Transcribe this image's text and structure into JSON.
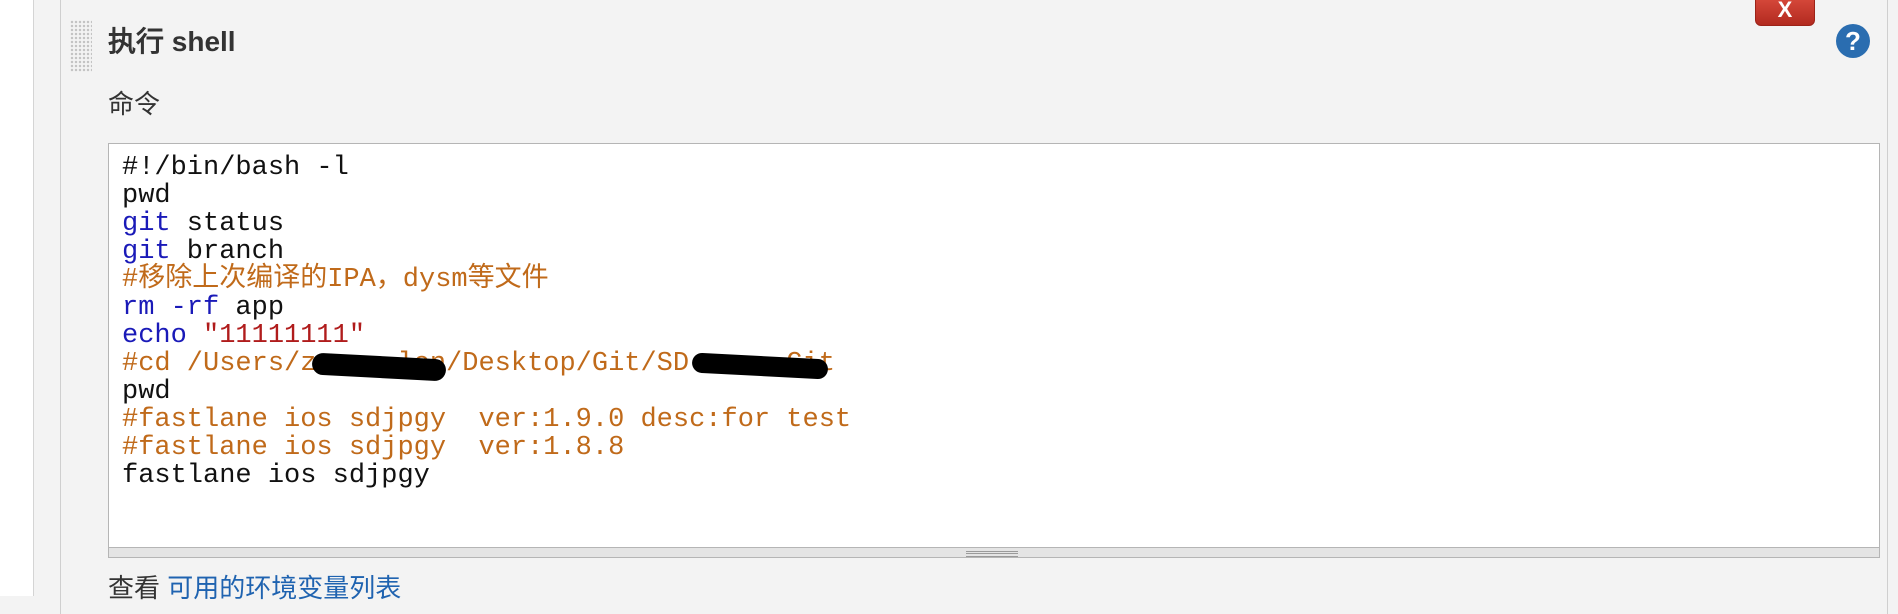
{
  "step": {
    "title": "执行 shell",
    "delete_label": "X",
    "help_label": "?",
    "help_icon": "question-circle-icon",
    "drag_icon": "drag-handle-icon"
  },
  "command": {
    "label": "命令",
    "lines": [
      [
        {
          "t": "#!/bin/bash -l",
          "k": "plain"
        }
      ],
      [
        {
          "t": "pwd",
          "k": "plain"
        }
      ],
      [
        {
          "t": "git",
          "k": "kw"
        },
        {
          "t": " status",
          "k": "plain"
        }
      ],
      [
        {
          "t": "git",
          "k": "kw"
        },
        {
          "t": " branch",
          "k": "plain"
        }
      ],
      [
        {
          "t": "#移除上次编译的IPA，dysm等文件",
          "k": "cmt"
        }
      ],
      [
        {
          "t": "rm",
          "k": "kw"
        },
        {
          "t": " ",
          "k": "plain"
        },
        {
          "t": "-rf",
          "k": "kw"
        },
        {
          "t": " app",
          "k": "plain"
        }
      ],
      [
        {
          "t": "echo",
          "k": "kw"
        },
        {
          "t": " ",
          "k": "plain"
        },
        {
          "t": "\"11111111\"",
          "k": "str"
        }
      ],
      [
        {
          "t": "#cd /Users/zen   len/Desktop/Git/SD      Git",
          "k": "cmt"
        }
      ],
      [
        {
          "t": "pwd",
          "k": "plain"
        }
      ],
      [
        {
          "t": "#fastlane ios sdjpgy  ver:1.9.0 desc:for test",
          "k": "cmt"
        }
      ],
      [
        {
          "t": "#fastlane ios sdjpgy  ver:1.8.8",
          "k": "cmt"
        }
      ],
      [
        {
          "t": "fastlane ios sdjpgy",
          "k": "plain"
        }
      ]
    ]
  },
  "footer": {
    "prefix": "查看 ",
    "link_label": "可用的环境变量列表"
  },
  "colors": {
    "keyword": "#1a1ab8",
    "string": "#b01c1c",
    "comment": "#c06a1a",
    "link": "#1f63b0",
    "delete_button": "#c0392b",
    "help_icon": "#2a6db0"
  }
}
